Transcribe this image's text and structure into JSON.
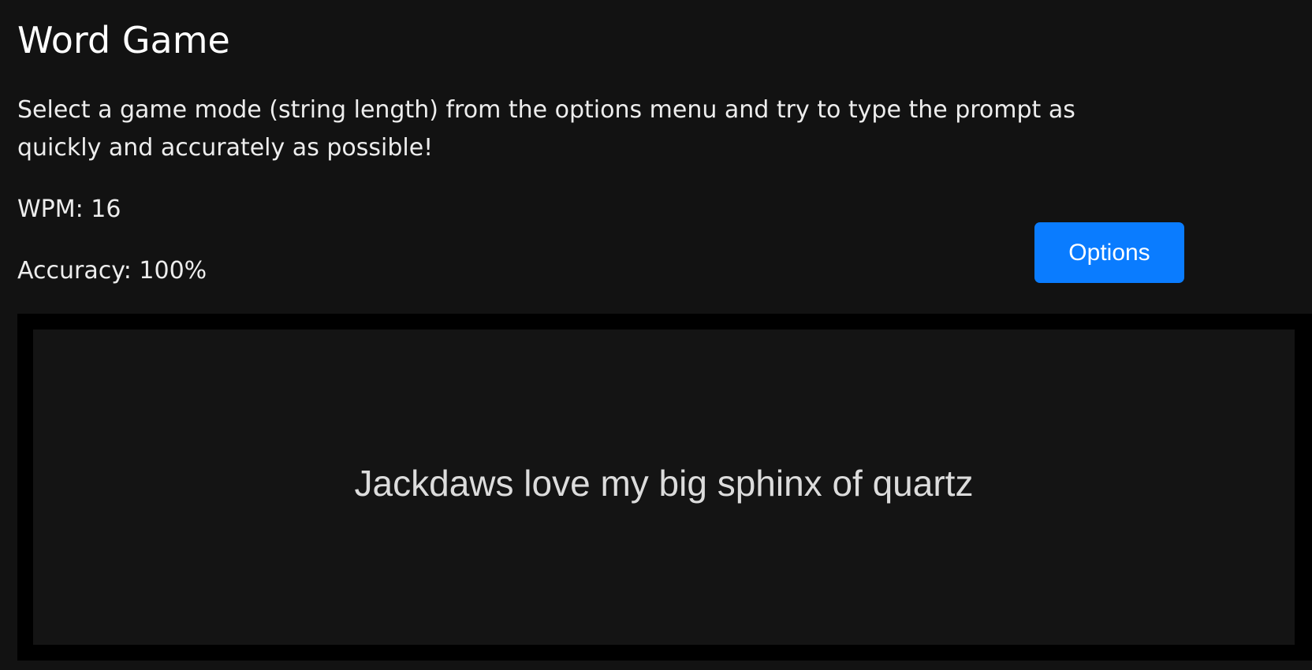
{
  "app": {
    "title": "Word Game",
    "instructions": "Select a game mode (string length) from the options menu and try to type the prompt as quickly and accurately as possible!"
  },
  "stats": {
    "wpm_label": "WPM: 16",
    "accuracy_label": "Accuracy: 100%"
  },
  "controls": {
    "options_label": "Options"
  },
  "game": {
    "prompt": "Jackdaws love my big sphinx of quartz"
  },
  "colors": {
    "background": "#121212",
    "accent": "#0a7cff",
    "canvas_border": "#000000",
    "canvas_fill": "#141414",
    "text": "#ededed"
  }
}
